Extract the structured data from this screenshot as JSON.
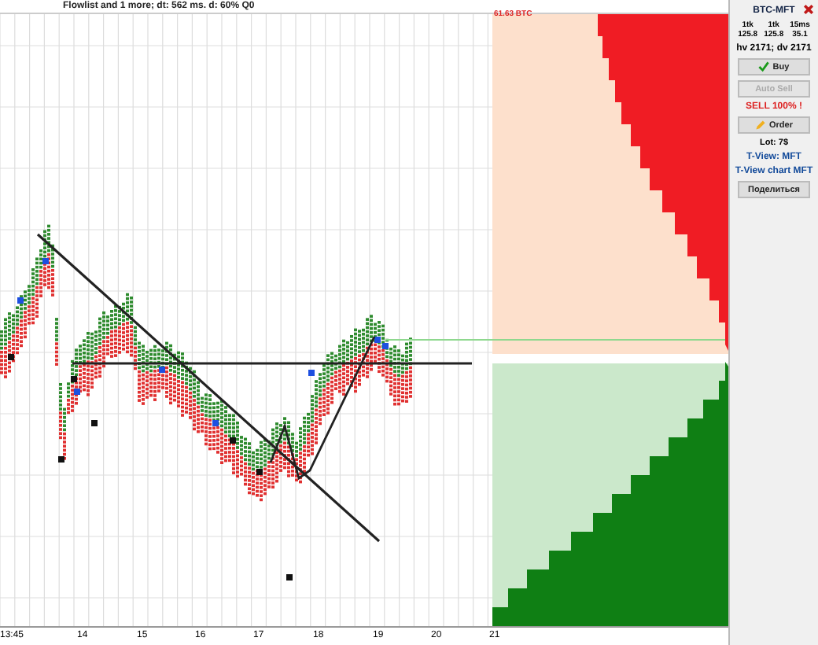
{
  "header": {
    "text": "Flowlist and 1 more;  dt: 562 ms.  d: 60% Q0"
  },
  "price_label": "61.63 BTC",
  "x_axis": {
    "labels": [
      "13:45",
      "14",
      "15",
      "16",
      "17",
      "18",
      "19",
      "20",
      "21"
    ]
  },
  "panel": {
    "title": "BTC-MFT",
    "stats": [
      {
        "label": "1tk",
        "value": "125.8"
      },
      {
        "label": "1tk",
        "value": "125.8"
      },
      {
        "label": "15ms",
        "value": "35.1"
      }
    ],
    "volumes": "hv 2171; dv 2171",
    "items": [
      {
        "kind": "buy",
        "label": "Buy",
        "disabled": false
      },
      {
        "kind": "button",
        "label": "Auto Sell",
        "disabled": true
      },
      {
        "kind": "signal",
        "label": "SELL 100% !"
      },
      {
        "kind": "order",
        "label": "Order",
        "disabled": false
      },
      {
        "kind": "text",
        "label": "Lot: 7$"
      },
      {
        "kind": "link",
        "label": "T-View: MFT"
      },
      {
        "kind": "link",
        "label": "T-View chart MFT"
      },
      {
        "kind": "button",
        "label": "Поделиться",
        "disabled": false
      }
    ]
  }
}
